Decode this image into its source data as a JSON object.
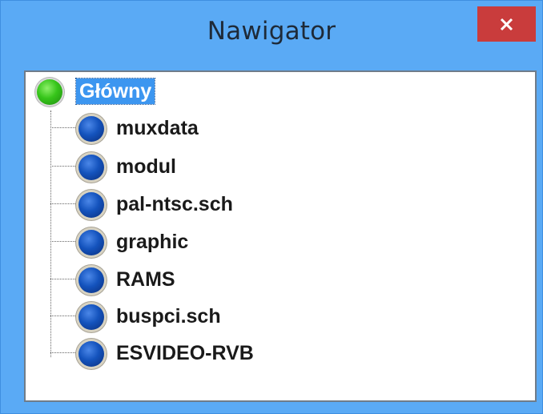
{
  "window": {
    "title": "Nawigator",
    "close_glyph": "✕"
  },
  "tree": {
    "root": {
      "label": "Główny",
      "icon": "green-ball-icon",
      "selected": true
    },
    "children": [
      {
        "label": "muxdata",
        "icon": "blue-ball-icon"
      },
      {
        "label": "modul",
        "icon": "blue-ball-icon"
      },
      {
        "label": "pal-ntsc.sch",
        "icon": "blue-ball-icon"
      },
      {
        "label": "graphic",
        "icon": "blue-ball-icon"
      },
      {
        "label": "RAMS",
        "icon": "blue-ball-icon"
      },
      {
        "label": "buspci.sch",
        "icon": "blue-ball-icon"
      },
      {
        "label": "ESVIDEO-RVB",
        "icon": "blue-ball-icon"
      }
    ]
  },
  "colors": {
    "titlebar": "#5aaaf5",
    "close_button": "#c93c3c",
    "selection": "#3c96f0"
  }
}
